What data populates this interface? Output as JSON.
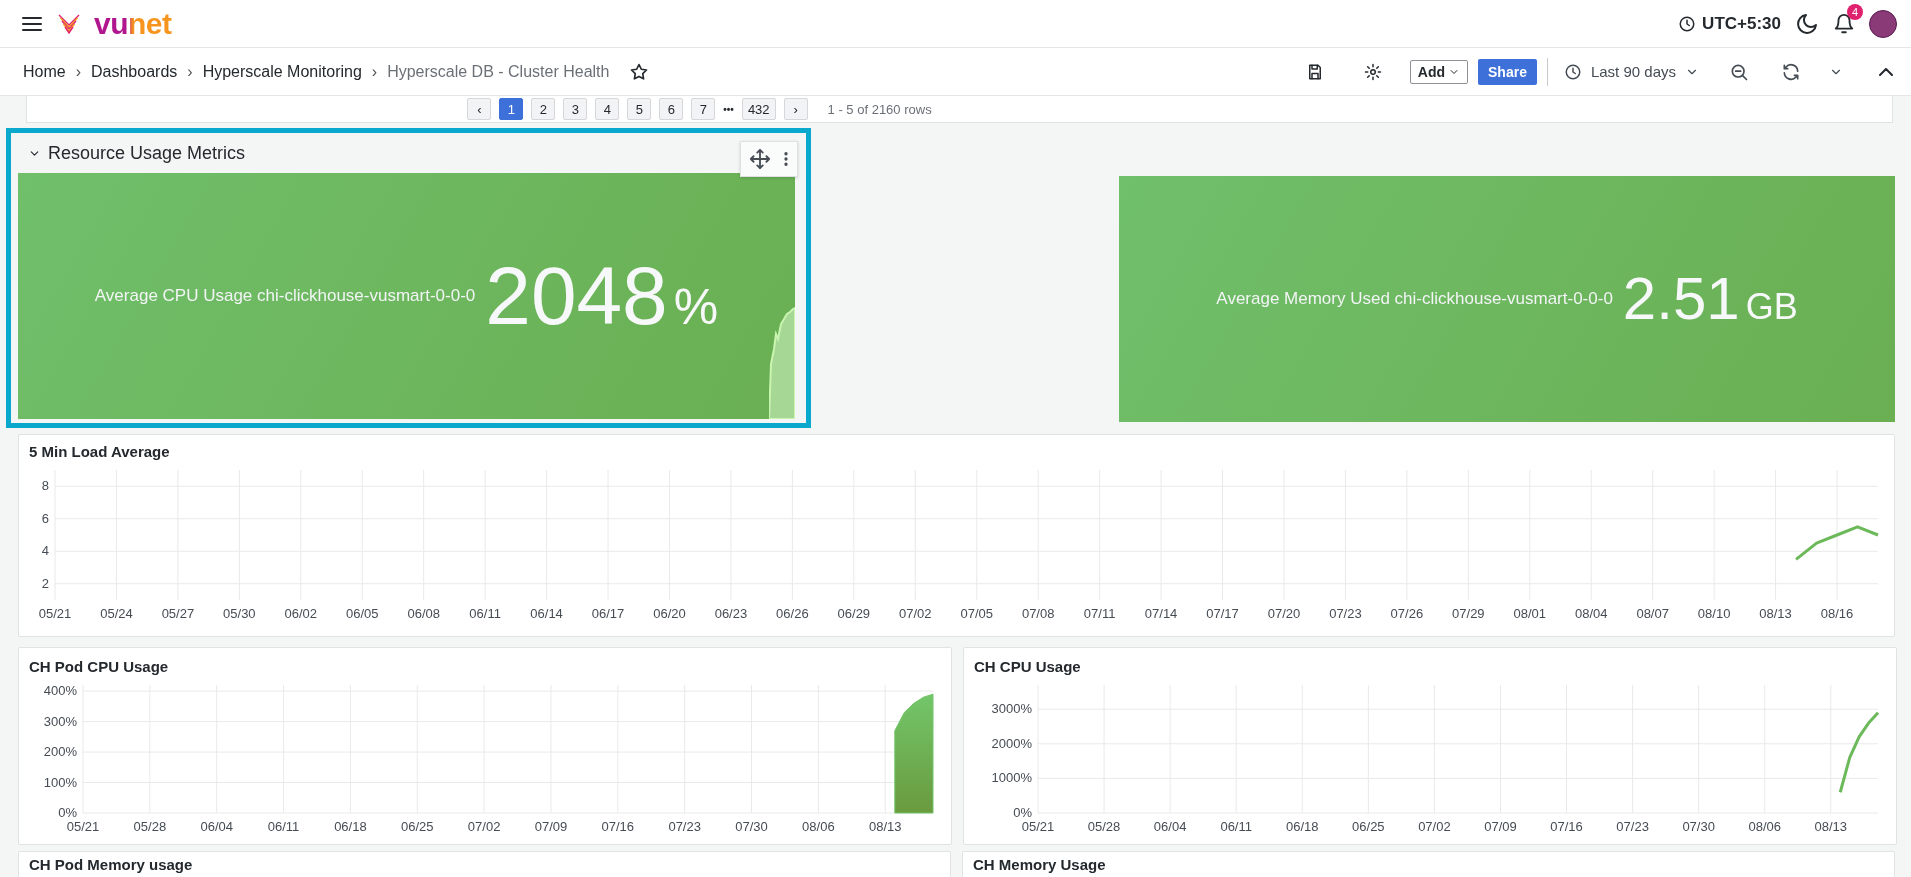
{
  "topbar": {
    "logo": "vunet",
    "timezone": "UTC+5:30",
    "notifications": "4"
  },
  "breadcrumbs": [
    {
      "label": "Home",
      "current": false
    },
    {
      "label": "Dashboards",
      "current": false
    },
    {
      "label": "Hyperscale Monitoring",
      "current": false
    },
    {
      "label": "Hyperscale DB - Cluster Health",
      "current": true
    }
  ],
  "separator": "›",
  "toolbar": {
    "add": "Add",
    "share": "Share",
    "time_range": "Last 90 days"
  },
  "pagination": {
    "prev": "‹",
    "pages": [
      {
        "label": "1",
        "selected": true
      },
      {
        "label": "2",
        "selected": false
      },
      {
        "label": "3",
        "selected": false
      },
      {
        "label": "4",
        "selected": false
      },
      {
        "label": "5",
        "selected": false
      },
      {
        "label": "6",
        "selected": false
      },
      {
        "label": "7",
        "selected": false
      }
    ],
    "ellipsis": "•••",
    "last": "432",
    "next": "›",
    "summary": "1 - 5 of 2160 rows"
  },
  "row": {
    "title": "Resource Usage Metrics",
    "expanded": true,
    "highlighted": true,
    "stats": [
      {
        "label": "Average CPU Usage chi-clickhouse-vusmart-0-0-0",
        "value": "2048",
        "unit": "%",
        "sparkline": true
      },
      {
        "label": "Average Memory Used chi-clickhouse-vusmart-0-0-0",
        "value": "2.51",
        "unit": "GB",
        "sparkline": false
      }
    ]
  },
  "panels": [
    {
      "title": "5 Min Load Average",
      "chart_data": {
        "type": "line",
        "grid": true,
        "categories": [
          "05/21",
          null,
          null,
          "05/24",
          null,
          null,
          "05/27",
          null,
          null,
          "05/30",
          null,
          null,
          "06/02",
          null,
          null,
          "06/05",
          null,
          null,
          "06/08",
          null,
          null,
          "06/11",
          null,
          null,
          "06/14",
          null,
          null,
          "06/17",
          null,
          null,
          "06/20",
          null,
          null,
          "06/23",
          null,
          null,
          "06/26",
          null,
          null,
          "06/29",
          null,
          null,
          "07/02",
          null,
          null,
          "07/05",
          null,
          null,
          "07/08",
          null,
          null,
          "07/11",
          null,
          null,
          "07/14",
          null,
          null,
          "07/17",
          null,
          null,
          "07/20",
          null,
          null,
          "07/23",
          null,
          null,
          "07/26",
          null,
          null,
          "07/29",
          null,
          null,
          "08/01",
          null,
          null,
          "08/04",
          null,
          null,
          "08/07",
          null,
          null,
          "08/10",
          null,
          null,
          "08/13",
          null,
          null,
          "08/16",
          null,
          null
        ],
        "series": [
          {
            "color": "#6cb95a",
            "values": [
              null,
              null,
              null,
              null,
              null,
              null,
              null,
              null,
              null,
              null,
              null,
              null,
              null,
              null,
              null,
              null,
              null,
              null,
              null,
              null,
              null,
              null,
              null,
              null,
              null,
              null,
              null,
              null,
              null,
              null,
              null,
              null,
              null,
              null,
              null,
              null,
              null,
              null,
              null,
              null,
              null,
              null,
              null,
              null,
              null,
              null,
              null,
              null,
              null,
              null,
              null,
              null,
              null,
              null,
              null,
              null,
              null,
              null,
              null,
              null,
              null,
              null,
              null,
              null,
              null,
              null,
              null,
              null,
              null,
              null,
              null,
              null,
              null,
              null,
              null,
              null,
              null,
              null,
              null,
              null,
              null,
              null,
              null,
              null,
              null,
              3.5,
              4.5,
              5,
              5.5,
              5
            ]
          }
        ],
        "ylim": [
          1,
          9
        ],
        "yticks": [
          2,
          4,
          6,
          8
        ]
      }
    },
    {
      "title": "CH Pod CPU Usage",
      "chart_data": {
        "type": "area",
        "grid": true,
        "categories": [
          "05/21",
          null,
          null,
          null,
          null,
          null,
          null,
          "05/28",
          null,
          null,
          null,
          null,
          null,
          null,
          "06/04",
          null,
          null,
          null,
          null,
          null,
          null,
          "06/11",
          null,
          null,
          null,
          null,
          null,
          null,
          "06/18",
          null,
          null,
          null,
          null,
          null,
          null,
          "06/25",
          null,
          null,
          null,
          null,
          null,
          null,
          "07/02",
          null,
          null,
          null,
          null,
          null,
          null,
          "07/09",
          null,
          null,
          null,
          null,
          null,
          null,
          "07/16",
          null,
          null,
          null,
          null,
          null,
          null,
          "07/23",
          null,
          null,
          null,
          null,
          null,
          null,
          "07/30",
          null,
          null,
          null,
          null,
          null,
          null,
          "08/06",
          null,
          null,
          null,
          null,
          null,
          null,
          "08/13",
          null,
          null,
          null,
          null,
          null
        ],
        "series": [
          {
            "color": "#73c66a",
            "values": [
              null,
              null,
              null,
              null,
              null,
              null,
              null,
              null,
              null,
              null,
              null,
              null,
              null,
              null,
              null,
              null,
              null,
              null,
              null,
              null,
              null,
              null,
              null,
              null,
              null,
              null,
              null,
              null,
              null,
              null,
              null,
              null,
              null,
              null,
              null,
              null,
              null,
              null,
              null,
              null,
              null,
              null,
              null,
              null,
              null,
              null,
              null,
              null,
              null,
              null,
              null,
              null,
              null,
              null,
              null,
              null,
              null,
              null,
              null,
              null,
              null,
              null,
              null,
              null,
              null,
              null,
              null,
              null,
              null,
              null,
              null,
              null,
              null,
              null,
              null,
              null,
              null,
              null,
              null,
              null,
              null,
              null,
              null,
              null,
              null,
              270,
              330,
              360,
              380,
              390
            ]
          }
        ],
        "ylim": [
          0,
          420
        ],
        "yticks": [
          {
            "value": 0,
            "label": "0%"
          },
          {
            "value": 100,
            "label": "100%"
          },
          {
            "value": 200,
            "label": "200%"
          },
          {
            "value": 300,
            "label": "300%"
          },
          {
            "value": 400,
            "label": "400%"
          }
        ]
      }
    },
    {
      "title": "CH CPU Usage",
      "chart_data": {
        "type": "line",
        "grid": true,
        "categories": [
          "05/21",
          null,
          null,
          null,
          null,
          null,
          null,
          "05/28",
          null,
          null,
          null,
          null,
          null,
          null,
          "06/04",
          null,
          null,
          null,
          null,
          null,
          null,
          "06/11",
          null,
          null,
          null,
          null,
          null,
          null,
          "06/18",
          null,
          null,
          null,
          null,
          null,
          null,
          "06/25",
          null,
          null,
          null,
          null,
          null,
          null,
          "07/02",
          null,
          null,
          null,
          null,
          null,
          null,
          "07/09",
          null,
          null,
          null,
          null,
          null,
          null,
          "07/16",
          null,
          null,
          null,
          null,
          null,
          null,
          "07/23",
          null,
          null,
          null,
          null,
          null,
          null,
          "07/30",
          null,
          null,
          null,
          null,
          null,
          null,
          "08/06",
          null,
          null,
          null,
          null,
          null,
          null,
          "08/13",
          null,
          null,
          null,
          null,
          null
        ],
        "series": [
          {
            "color": "#6cb95a",
            "values": [
              null,
              null,
              null,
              null,
              null,
              null,
              null,
              null,
              null,
              null,
              null,
              null,
              null,
              null,
              null,
              null,
              null,
              null,
              null,
              null,
              null,
              null,
              null,
              null,
              null,
              null,
              null,
              null,
              null,
              null,
              null,
              null,
              null,
              null,
              null,
              null,
              null,
              null,
              null,
              null,
              null,
              null,
              null,
              null,
              null,
              null,
              null,
              null,
              null,
              null,
              null,
              null,
              null,
              null,
              null,
              null,
              null,
              null,
              null,
              null,
              null,
              null,
              null,
              null,
              null,
              null,
              null,
              null,
              null,
              null,
              null,
              null,
              null,
              null,
              null,
              null,
              null,
              null,
              null,
              null,
              null,
              null,
              null,
              null,
              null,
              600,
              1600,
              2200,
              2600,
              2900
            ]
          }
        ],
        "ylim": [
          0,
          3700
        ],
        "yticks": [
          {
            "value": 0,
            "label": "0%"
          },
          {
            "value": 1000,
            "label": "1000%"
          },
          {
            "value": 2000,
            "label": "2000%"
          },
          {
            "value": 3000,
            "label": "3000%"
          }
        ]
      }
    }
  ],
  "cut_panels": [
    {
      "title": "CH Pod Memory usage"
    },
    {
      "title": "CH Memory Usage"
    }
  ]
}
